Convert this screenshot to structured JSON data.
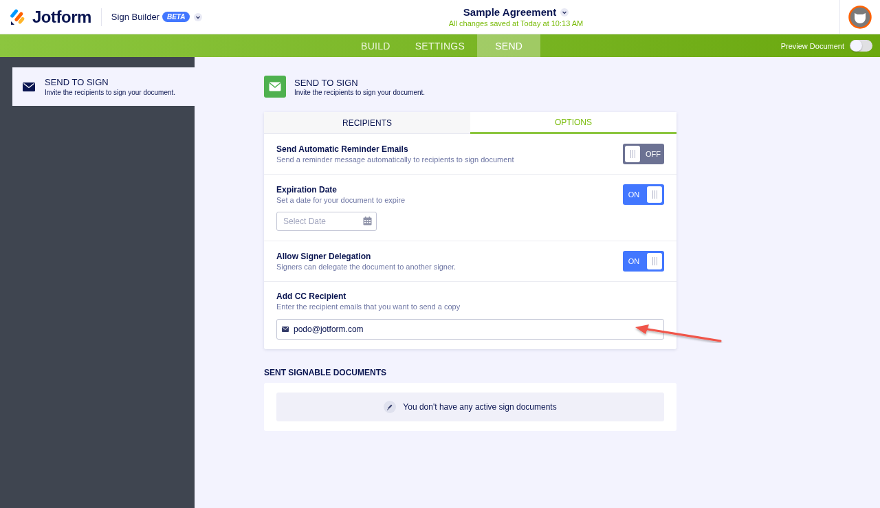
{
  "header": {
    "logo": "Jotform",
    "product": "Sign Builder",
    "badge": "BETA",
    "document_title": "Sample Agreement",
    "save_status": "All changes saved at Today at 10:13 AM"
  },
  "nav": {
    "tabs": [
      {
        "label": "BUILD",
        "selected": false
      },
      {
        "label": "SETTINGS",
        "selected": false
      },
      {
        "label": "SEND",
        "selected": true
      }
    ],
    "preview": {
      "label": "Preview Document",
      "on": false
    }
  },
  "sidebar": {
    "items": [
      {
        "title": "SEND TO SIGN",
        "subtitle": "Invite the recipients to sign your document.",
        "selected": true
      }
    ]
  },
  "section": {
    "title": "SEND TO SIGN",
    "subtitle": "Invite the recipients to sign your document."
  },
  "options_panel": {
    "tabs": [
      {
        "label": "RECIPIENTS",
        "selected": false
      },
      {
        "label": "OPTIONS",
        "selected": true
      }
    ],
    "rows": [
      {
        "kind": "toggle",
        "title": "Send Automatic Reminder Emails",
        "description": "Send a reminder message automatically to recipients to sign document",
        "on": false,
        "toggle_label": "OFF"
      },
      {
        "kind": "toggle",
        "title": "Expiration Date",
        "description": "Set a date for your document to expire",
        "on": true,
        "toggle_label": "ON",
        "date_field": {
          "placeholder": "Select Date"
        }
      },
      {
        "kind": "toggle",
        "title": "Allow Signer Delegation",
        "description": "Signers can delegate the document to another signer.",
        "on": true,
        "toggle_label": "ON"
      },
      {
        "kind": "email",
        "title": "Add CC Recipient",
        "description": "Enter the recipient emails that you want to send a copy",
        "value": "podo@jotform.com"
      }
    ]
  },
  "sent": {
    "heading": "SENT SIGNABLE DOCUMENTS",
    "empty_message": "You don't have any active sign documents"
  }
}
